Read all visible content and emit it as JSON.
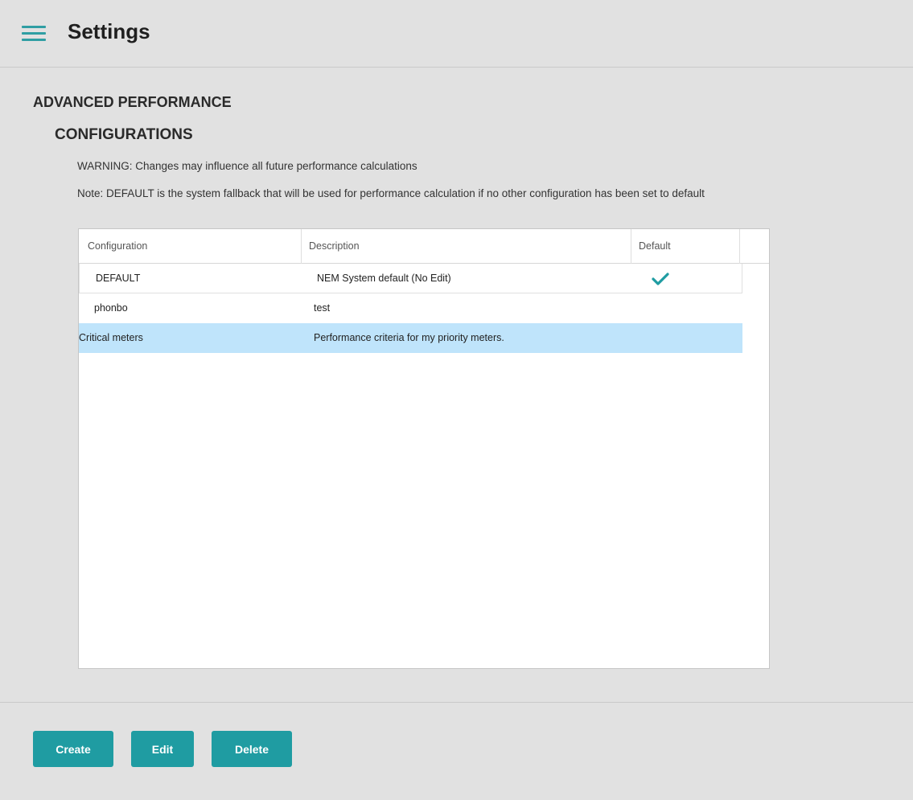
{
  "header": {
    "title": "Settings",
    "menu_icon": "hamburger-menu-icon"
  },
  "section": {
    "title": "ADVANCED PERFORMANCE",
    "subtitle": "CONFIGURATIONS",
    "warning": "WARNING: Changes may influence all future performance calculations",
    "note": "Note: DEFAULT is the system fallback that will be used for performance calculation if no other configuration has been set to default"
  },
  "table": {
    "columns": [
      "Configuration",
      "Description",
      "Default"
    ],
    "rows": [
      {
        "configuration": "DEFAULT",
        "description": "NEM System default (No Edit)",
        "default": true
      },
      {
        "configuration": "phonbo",
        "description": "test",
        "default": false
      },
      {
        "configuration": "Critical meters",
        "description": "Performance criteria for my priority meters.",
        "default": false,
        "selected": true
      }
    ],
    "default_icon": "checkmark-icon"
  },
  "footer": {
    "create_label": "Create",
    "edit_label": "Edit",
    "delete_label": "Delete"
  },
  "colors": {
    "accent": "#1f9ca2",
    "selected_row": "#bfe4fb",
    "background": "#e1e1e1"
  }
}
